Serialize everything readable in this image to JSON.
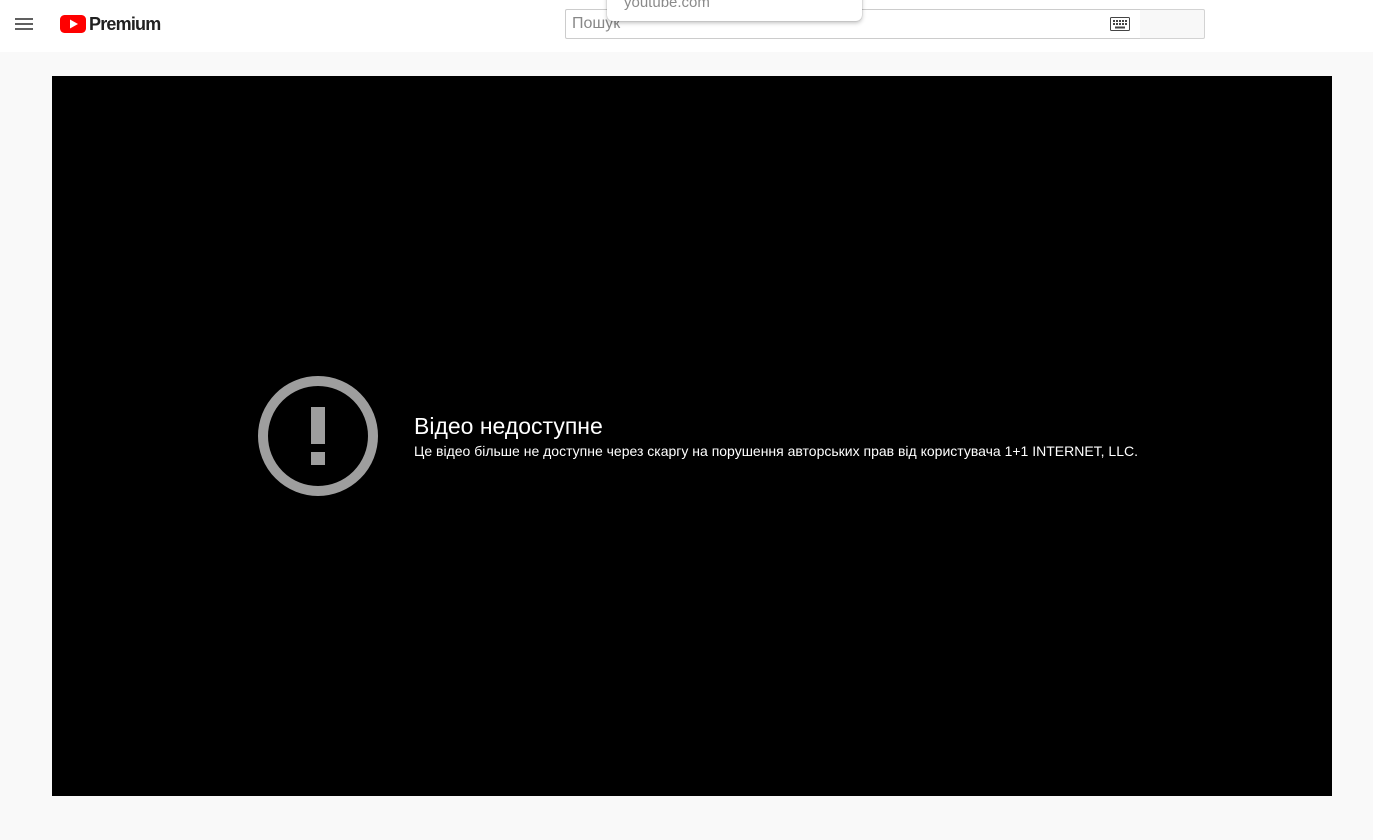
{
  "header": {
    "menu_icon": "hamburger-menu-icon",
    "logo": {
      "icon": "youtube-play-logo-icon",
      "text": "Premium",
      "brand_color": "#ff0000"
    },
    "search": {
      "placeholder": "Пошук",
      "value": "",
      "keyboard_icon": "keyboard-icon"
    },
    "autocomplete": {
      "items": [
        "youtube.com"
      ]
    }
  },
  "player": {
    "error": {
      "icon": "alert-circle-icon",
      "icon_color": "#9e9e9e",
      "title": "Відео недоступне",
      "subtitle": "Це відео більше не доступне через скаргу на порушення авторських прав від користувача 1+1 INTERNET, LLC."
    }
  }
}
